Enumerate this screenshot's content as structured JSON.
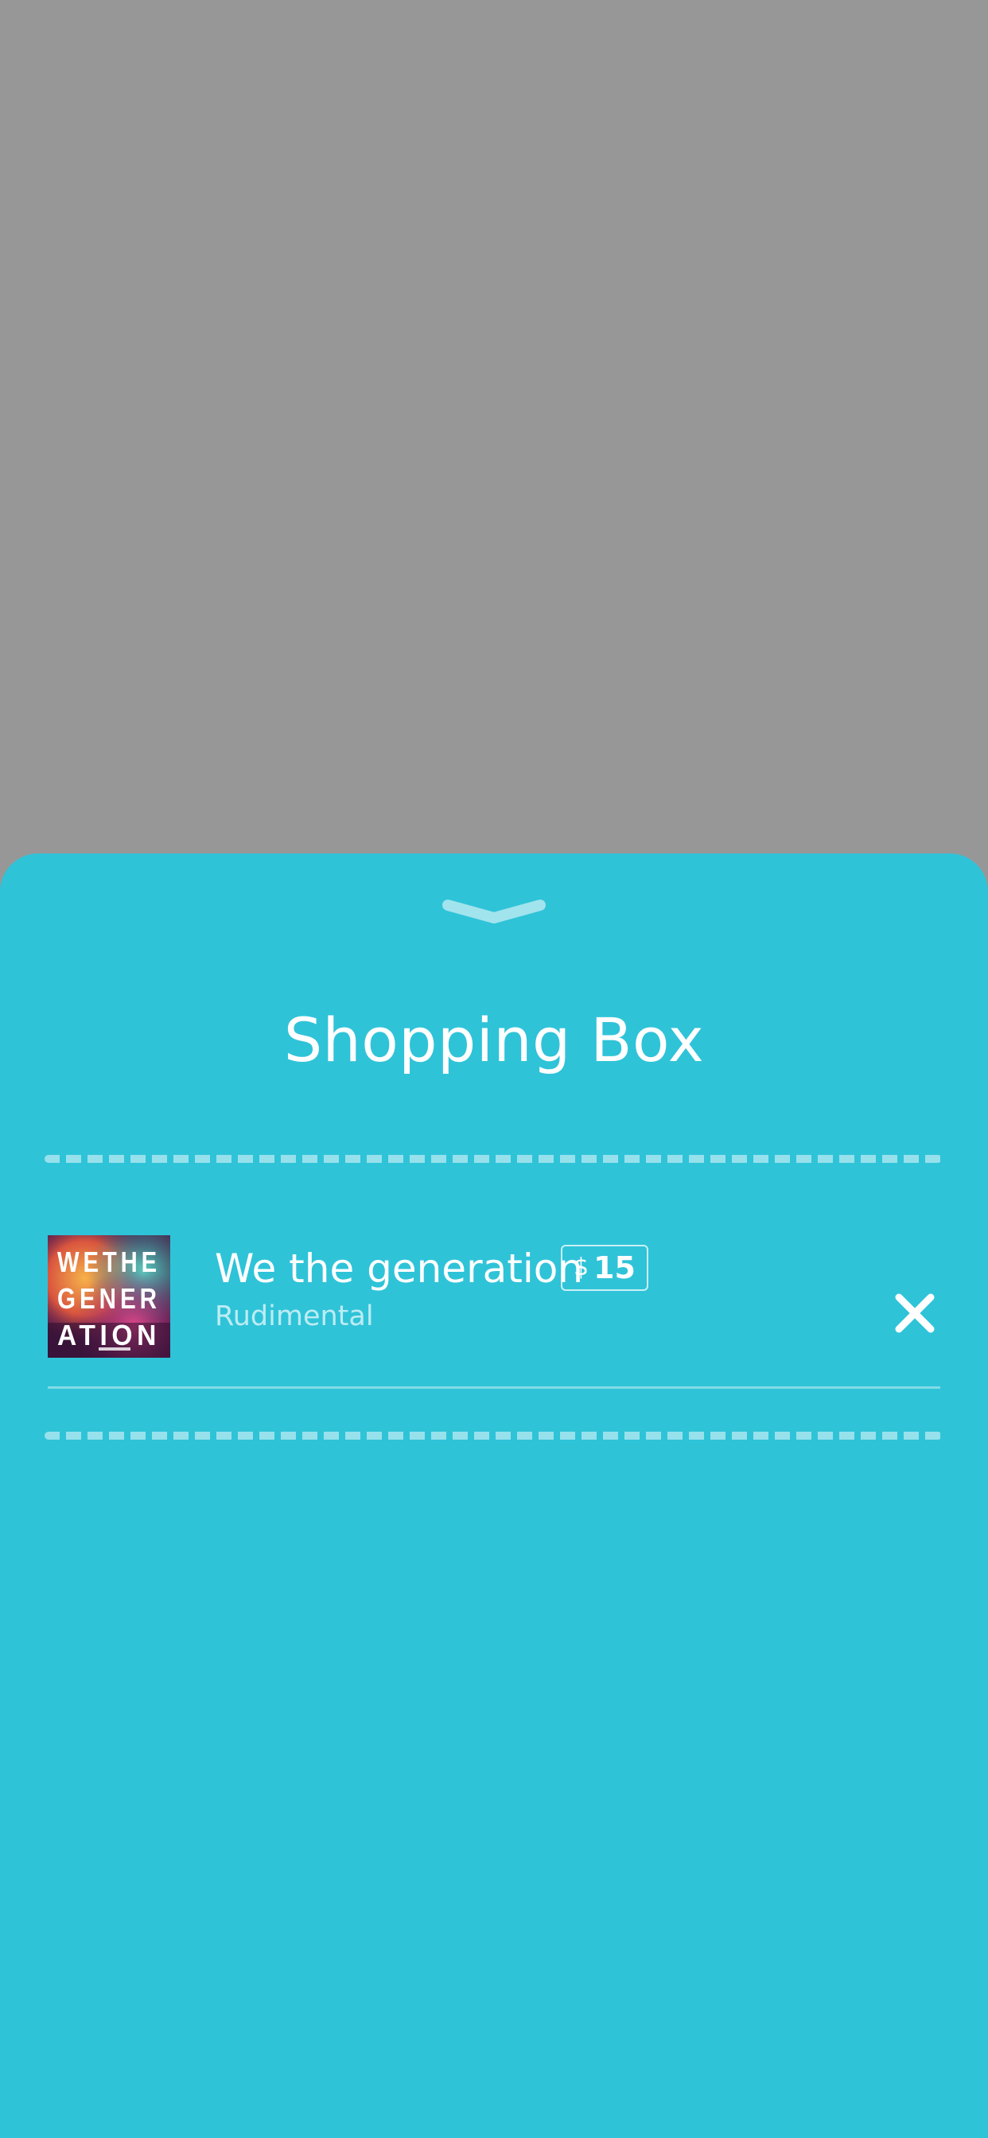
{
  "overlay": {
    "backdrop_color": "#979797"
  },
  "sheet": {
    "background_color": "#2fc3d8",
    "handle_icon": "chevron-down-icon",
    "title": "Shopping Box"
  },
  "cart": {
    "items": [
      {
        "title": "We the generation",
        "artist": "Rudimental",
        "currency": "$",
        "price": "15",
        "cover_icon": "album-cover-image",
        "cover_text": [
          "WETHE",
          "GENER",
          "ATION"
        ],
        "remove_icon": "close-icon"
      }
    ]
  }
}
